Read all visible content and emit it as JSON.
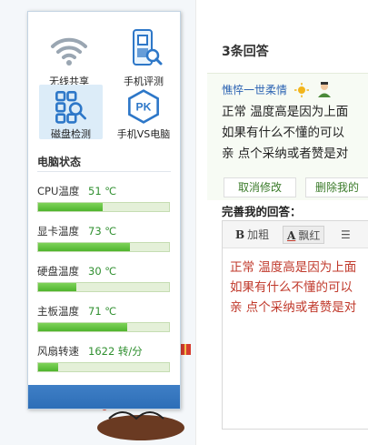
{
  "tools": [
    {
      "label": "无线共享",
      "icon": "wifi-icon"
    },
    {
      "label": "手机评测",
      "icon": "phone-test-icon"
    },
    {
      "label": "磁盘检测",
      "icon": "disk-check-icon",
      "active": true
    },
    {
      "label": "手机VS电脑",
      "icon": "pk-icon"
    }
  ],
  "status": {
    "title": "电脑状态",
    "metrics": [
      {
        "name": "CPU温度",
        "value": "51 ℃",
        "level": 0.49
      },
      {
        "name": "显卡温度",
        "value": "73 ℃",
        "level": 0.7
      },
      {
        "name": "硬盘温度",
        "value": "30 ℃",
        "level": 0.29
      },
      {
        "name": "主板温度",
        "value": "71 ℃",
        "level": 0.68
      },
      {
        "name": "风扇转速",
        "value": "1622 转/分",
        "level": 0.15
      }
    ]
  },
  "answers": {
    "title": "3条回答",
    "user": "憔悴一世柔情",
    "text_lines": [
      "正常 温度高是因为上面",
      "如果有什么不懂的可以",
      "亲 点个采纳或者赞是对"
    ],
    "cancel_label": "取消修改",
    "delete_label": "删除我的",
    "improve_title": "完善我的回答：",
    "toolbar": {
      "bold": "加粗",
      "red": "飘红",
      "list_glyph": "☰"
    },
    "editor_lines": [
      "正常 温度高是因为上面",
      "如果有什么不懂的可以",
      "亲 点个采纳或者赞是对"
    ]
  },
  "colors": {
    "accent": "#2d6eb7",
    "green": "#4fb42e",
    "red_text": "#c0392b"
  }
}
